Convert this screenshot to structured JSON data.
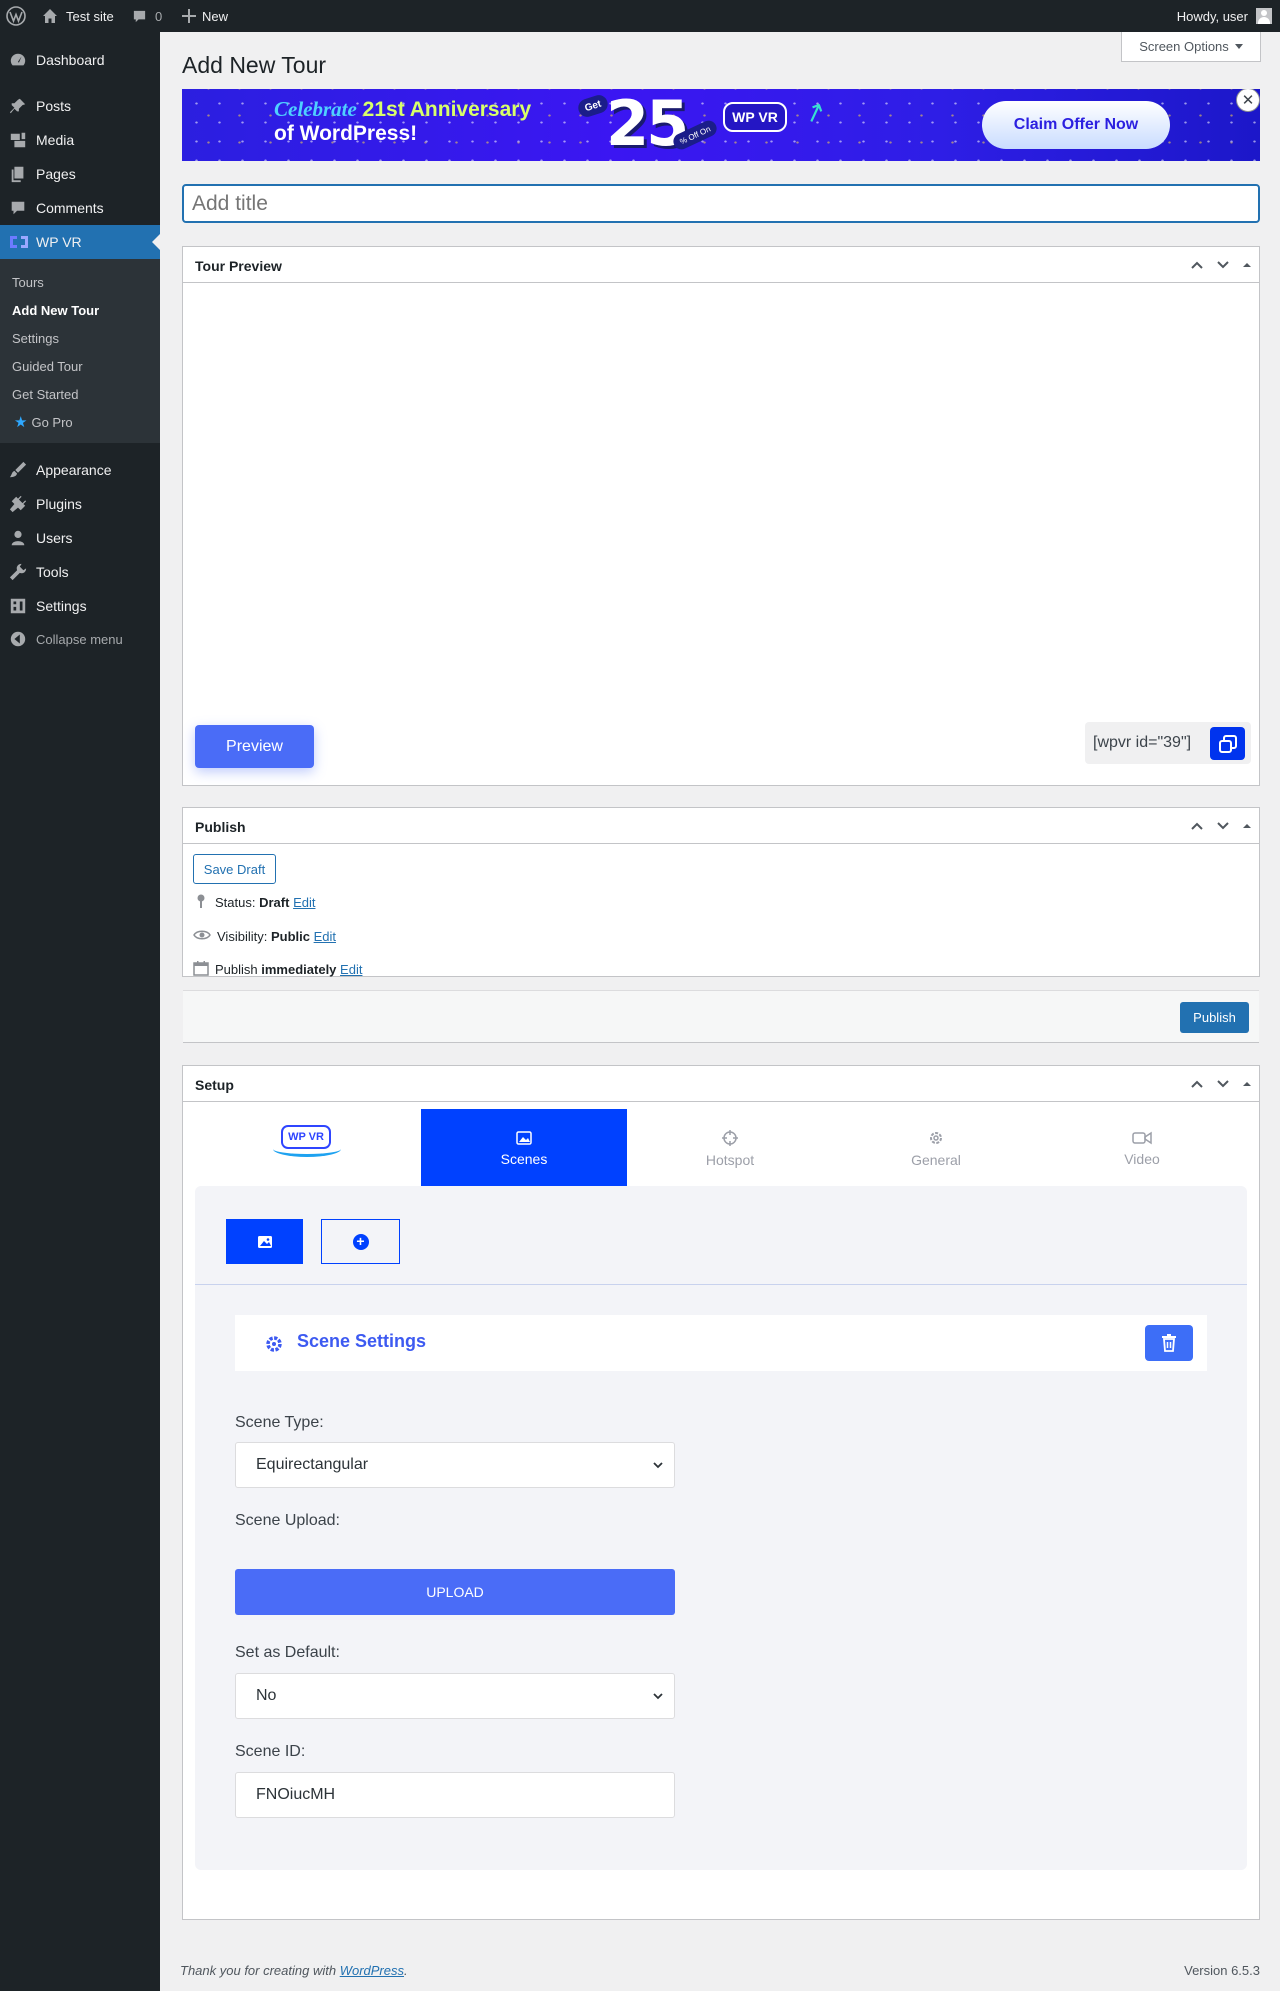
{
  "adminbar": {
    "site_name": "Test site",
    "comments_count": "0",
    "new_label": "New",
    "howdy": "Howdy, user"
  },
  "sidebar": {
    "items": [
      {
        "label": "Dashboard",
        "icon": "dashboard-icon"
      },
      {
        "label": "Posts",
        "icon": "pin-icon"
      },
      {
        "label": "Media",
        "icon": "media-icon"
      },
      {
        "label": "Pages",
        "icon": "pages-icon"
      },
      {
        "label": "Comments",
        "icon": "comment-icon"
      },
      {
        "label": "WP VR",
        "icon": "wpvr-icon"
      },
      {
        "label": "Appearance",
        "icon": "brush-icon"
      },
      {
        "label": "Plugins",
        "icon": "plugin-icon"
      },
      {
        "label": "Users",
        "icon": "user-icon"
      },
      {
        "label": "Tools",
        "icon": "wrench-icon"
      },
      {
        "label": "Settings",
        "icon": "settings-icon"
      },
      {
        "label": "Collapse menu",
        "icon": "collapse-icon"
      }
    ],
    "submenu": [
      "Tours",
      "Add New Tour",
      "Settings",
      "Guided Tour",
      "Get Started",
      "Go Pro"
    ]
  },
  "page": {
    "title": "Add New Tour",
    "screen_options": "Screen Options",
    "title_placeholder": "Add title"
  },
  "banner": {
    "line1a": "Celebrate",
    "line1b": "21st Anniversary",
    "line2": "of WordPress!",
    "get": "Get",
    "number": "25",
    "off": "% Off On",
    "badge": "WP VR",
    "cta": "Claim Offer Now"
  },
  "preview": {
    "heading": "Tour Preview",
    "button": "Preview",
    "shortcode": "[wpvr id=\"39\"]"
  },
  "publish": {
    "heading": "Publish",
    "save_draft": "Save Draft",
    "status_label": "Status:",
    "status_value": "Draft",
    "visibility_label": "Visibility:",
    "visibility_value": "Public",
    "publish_label": "Publish",
    "publish_value": "immediately",
    "edit": "Edit",
    "publish_button": "Publish"
  },
  "setup": {
    "heading": "Setup",
    "logo": "WP VR",
    "tabs": [
      "Scenes",
      "Hotspot",
      "General",
      "Video"
    ],
    "scene_settings": "Scene Settings",
    "scene_type_label": "Scene Type:",
    "scene_type_value": "Equirectangular",
    "scene_upload_label": "Scene Upload:",
    "upload_button": "UPLOAD",
    "default_label": "Set as Default:",
    "default_value": "No",
    "scene_id_label": "Scene ID:",
    "scene_id_value": "FNOiucMH"
  },
  "footer": {
    "thanks": "Thank you for creating with ",
    "link": "WordPress",
    "period": ".",
    "version": "Version 6.5.3"
  },
  "colors": {
    "admin_dark": "#1d2327",
    "wp_blue": "#2271b1",
    "wpvr_blue": "#0041ff",
    "button_blue": "#4a6cf7"
  }
}
